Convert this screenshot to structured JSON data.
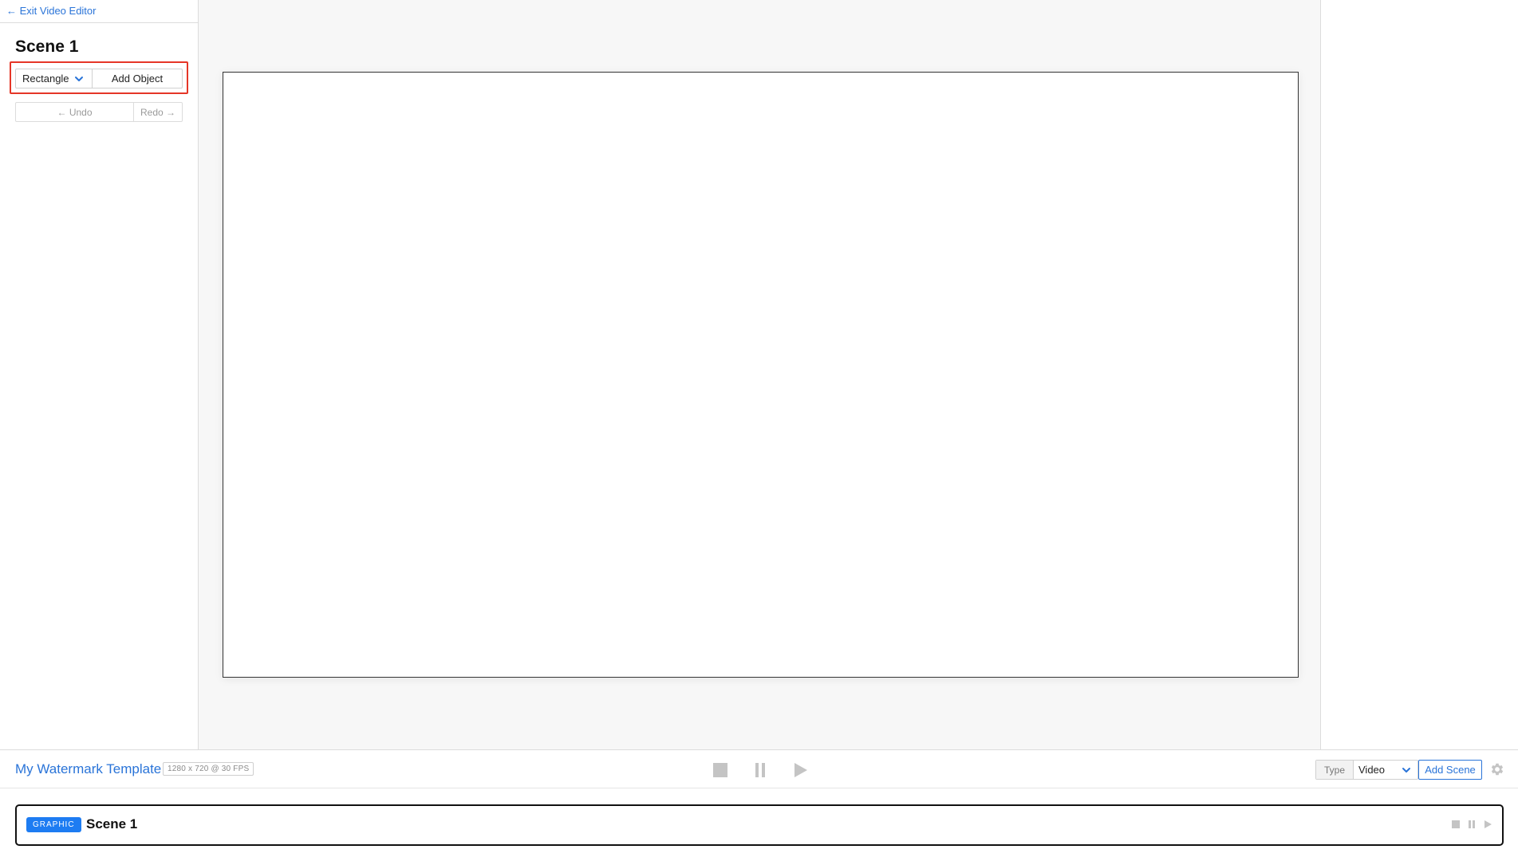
{
  "sidebar": {
    "exit_link": "← Exit Video Editor",
    "scene_title": "Scene 1",
    "shape_select": {
      "value": "Rectangle",
      "icon": "chevron-down-icon"
    },
    "add_object_label": "Add Object",
    "undo_label": "← Undo",
    "redo_label": "Redo →"
  },
  "bottom_bar": {
    "project_title": "My Watermark Template",
    "project_meta": "1280 x 720 @ 30 FPS",
    "transport": [
      "stop-icon",
      "pause-icon",
      "play-icon"
    ],
    "type_label": "Type",
    "type_value": "Video",
    "add_scene_label": "Add Scene",
    "settings_icon": "gear-icon"
  },
  "scenes": [
    {
      "badge": "GRAPHIC",
      "name": "Scene 1"
    }
  ],
  "colors": {
    "accent": "#2a74d8",
    "badge": "#1d7cf2",
    "highlight": "#e53627",
    "stage_bg": "#f7f7f7"
  }
}
